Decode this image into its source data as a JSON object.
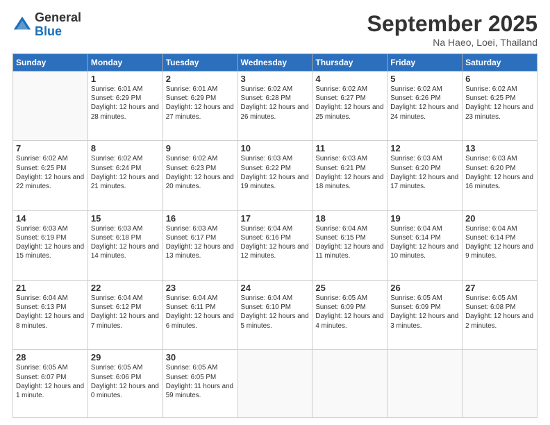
{
  "logo": {
    "general": "General",
    "blue": "Blue"
  },
  "header": {
    "month": "September 2025",
    "location": "Na Haeo, Loei, Thailand"
  },
  "days_of_week": [
    "Sunday",
    "Monday",
    "Tuesday",
    "Wednesday",
    "Thursday",
    "Friday",
    "Saturday"
  ],
  "weeks": [
    [
      {
        "day": "",
        "info": ""
      },
      {
        "day": "1",
        "info": "Sunrise: 6:01 AM\nSunset: 6:29 PM\nDaylight: 12 hours\nand 28 minutes."
      },
      {
        "day": "2",
        "info": "Sunrise: 6:01 AM\nSunset: 6:29 PM\nDaylight: 12 hours\nand 27 minutes."
      },
      {
        "day": "3",
        "info": "Sunrise: 6:02 AM\nSunset: 6:28 PM\nDaylight: 12 hours\nand 26 minutes."
      },
      {
        "day": "4",
        "info": "Sunrise: 6:02 AM\nSunset: 6:27 PM\nDaylight: 12 hours\nand 25 minutes."
      },
      {
        "day": "5",
        "info": "Sunrise: 6:02 AM\nSunset: 6:26 PM\nDaylight: 12 hours\nand 24 minutes."
      },
      {
        "day": "6",
        "info": "Sunrise: 6:02 AM\nSunset: 6:25 PM\nDaylight: 12 hours\nand 23 minutes."
      }
    ],
    [
      {
        "day": "7",
        "info": "Sunrise: 6:02 AM\nSunset: 6:25 PM\nDaylight: 12 hours\nand 22 minutes."
      },
      {
        "day": "8",
        "info": "Sunrise: 6:02 AM\nSunset: 6:24 PM\nDaylight: 12 hours\nand 21 minutes."
      },
      {
        "day": "9",
        "info": "Sunrise: 6:02 AM\nSunset: 6:23 PM\nDaylight: 12 hours\nand 20 minutes."
      },
      {
        "day": "10",
        "info": "Sunrise: 6:03 AM\nSunset: 6:22 PM\nDaylight: 12 hours\nand 19 minutes."
      },
      {
        "day": "11",
        "info": "Sunrise: 6:03 AM\nSunset: 6:21 PM\nDaylight: 12 hours\nand 18 minutes."
      },
      {
        "day": "12",
        "info": "Sunrise: 6:03 AM\nSunset: 6:20 PM\nDaylight: 12 hours\nand 17 minutes."
      },
      {
        "day": "13",
        "info": "Sunrise: 6:03 AM\nSunset: 6:20 PM\nDaylight: 12 hours\nand 16 minutes."
      }
    ],
    [
      {
        "day": "14",
        "info": "Sunrise: 6:03 AM\nSunset: 6:19 PM\nDaylight: 12 hours\nand 15 minutes."
      },
      {
        "day": "15",
        "info": "Sunrise: 6:03 AM\nSunset: 6:18 PM\nDaylight: 12 hours\nand 14 minutes."
      },
      {
        "day": "16",
        "info": "Sunrise: 6:03 AM\nSunset: 6:17 PM\nDaylight: 12 hours\nand 13 minutes."
      },
      {
        "day": "17",
        "info": "Sunrise: 6:04 AM\nSunset: 6:16 PM\nDaylight: 12 hours\nand 12 minutes."
      },
      {
        "day": "18",
        "info": "Sunrise: 6:04 AM\nSunset: 6:15 PM\nDaylight: 12 hours\nand 11 minutes."
      },
      {
        "day": "19",
        "info": "Sunrise: 6:04 AM\nSunset: 6:14 PM\nDaylight: 12 hours\nand 10 minutes."
      },
      {
        "day": "20",
        "info": "Sunrise: 6:04 AM\nSunset: 6:14 PM\nDaylight: 12 hours\nand 9 minutes."
      }
    ],
    [
      {
        "day": "21",
        "info": "Sunrise: 6:04 AM\nSunset: 6:13 PM\nDaylight: 12 hours\nand 8 minutes."
      },
      {
        "day": "22",
        "info": "Sunrise: 6:04 AM\nSunset: 6:12 PM\nDaylight: 12 hours\nand 7 minutes."
      },
      {
        "day": "23",
        "info": "Sunrise: 6:04 AM\nSunset: 6:11 PM\nDaylight: 12 hours\nand 6 minutes."
      },
      {
        "day": "24",
        "info": "Sunrise: 6:04 AM\nSunset: 6:10 PM\nDaylight: 12 hours\nand 5 minutes."
      },
      {
        "day": "25",
        "info": "Sunrise: 6:05 AM\nSunset: 6:09 PM\nDaylight: 12 hours\nand 4 minutes."
      },
      {
        "day": "26",
        "info": "Sunrise: 6:05 AM\nSunset: 6:09 PM\nDaylight: 12 hours\nand 3 minutes."
      },
      {
        "day": "27",
        "info": "Sunrise: 6:05 AM\nSunset: 6:08 PM\nDaylight: 12 hours\nand 2 minutes."
      }
    ],
    [
      {
        "day": "28",
        "info": "Sunrise: 6:05 AM\nSunset: 6:07 PM\nDaylight: 12 hours\nand 1 minute."
      },
      {
        "day": "29",
        "info": "Sunrise: 6:05 AM\nSunset: 6:06 PM\nDaylight: 12 hours\nand 0 minutes."
      },
      {
        "day": "30",
        "info": "Sunrise: 6:05 AM\nSunset: 6:05 PM\nDaylight: 11 hours\nand 59 minutes."
      },
      {
        "day": "",
        "info": ""
      },
      {
        "day": "",
        "info": ""
      },
      {
        "day": "",
        "info": ""
      },
      {
        "day": "",
        "info": ""
      }
    ]
  ]
}
